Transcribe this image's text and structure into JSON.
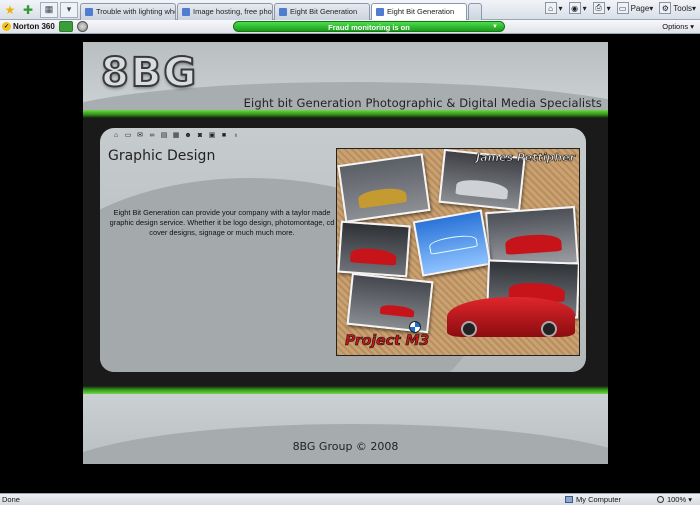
{
  "browser": {
    "tabs": [
      {
        "label": "Trouble with lighting when ta...",
        "active": false
      },
      {
        "label": "Image hosting, free photo sh...",
        "active": false
      },
      {
        "label": "Eight Bit Generation",
        "active": false
      },
      {
        "label": "Eight Bit Generation",
        "active": true
      }
    ],
    "toolbar": {
      "page_label": "Page",
      "tools_label": "Tools"
    },
    "norton": {
      "brand": "Norton 360",
      "fraud_text": "Fraud monitoring is on",
      "options_label": "Options"
    },
    "status": {
      "text": "Done",
      "zone": "My Computer",
      "zoom": "100%"
    }
  },
  "site": {
    "logo": "8BG",
    "tagline": "Eight bit Generation Photographic & Digital Media Specialists",
    "nav_icons": [
      "home-icon",
      "monitor-icon",
      "mail-icon",
      "glasses-icon",
      "film-icon",
      "calendar-icon",
      "person-icon",
      "camera-icon",
      "tv-icon",
      "video-icon",
      "bulb-icon"
    ],
    "section_title": "Graphic Design",
    "description": "Eight Bit Generation can provide your company with a taylor made graphic design service. Whether it be logo design, photomontage, cd cover designs, signage or much much more.",
    "photo": {
      "title": "James Pettipher",
      "label": "Project M3"
    },
    "footer": "8BG Group © 2008"
  },
  "colors": {
    "accent_green": "#3fb51f",
    "panel_grey": "#b9bfc1",
    "fraud_green": "#2fbf2f"
  }
}
